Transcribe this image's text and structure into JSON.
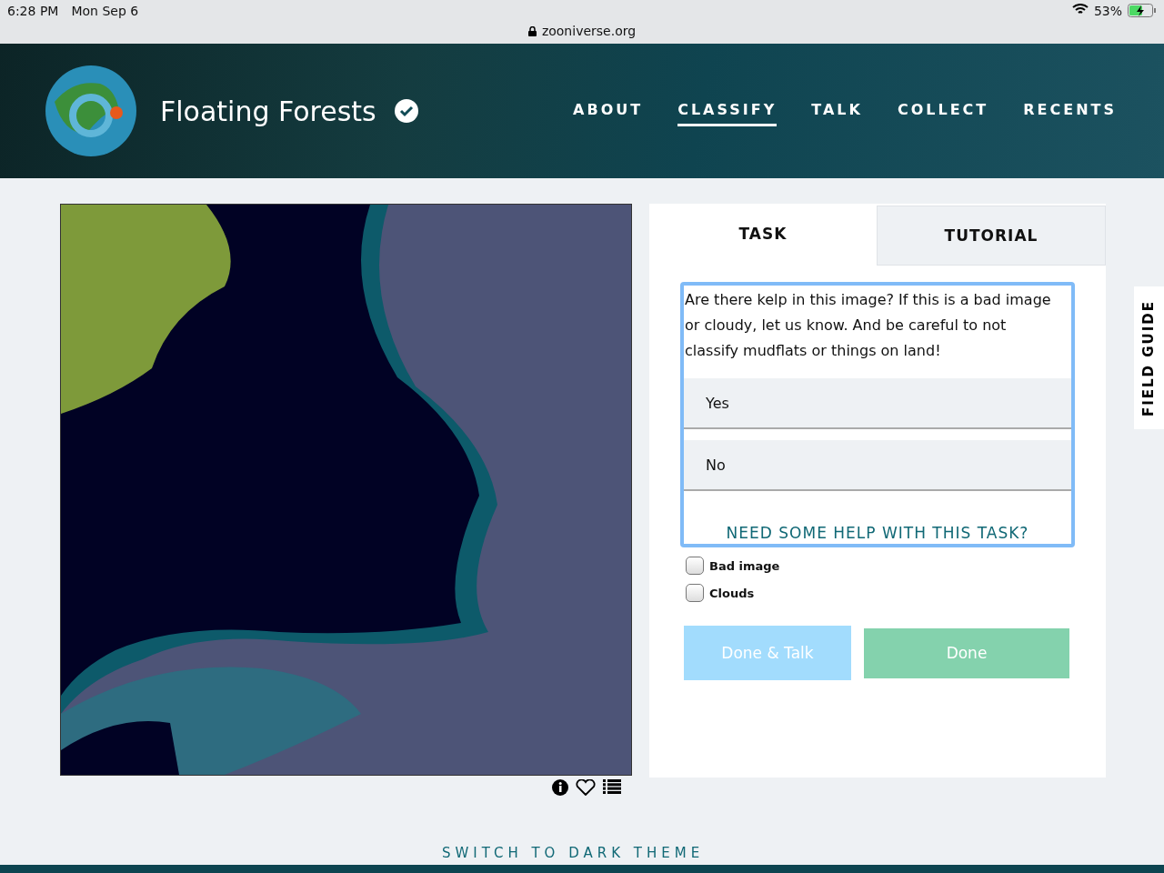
{
  "status_bar": {
    "time": "6:28 PM",
    "date": "Mon Sep 6",
    "battery": "53%",
    "address": "zooniverse.org"
  },
  "header": {
    "title": "Floating Forests",
    "verified": true,
    "nav": [
      {
        "label": "ABOUT",
        "selected": false
      },
      {
        "label": "CLASSIFY",
        "selected": true
      },
      {
        "label": "TALK",
        "selected": false
      },
      {
        "label": "COLLECT",
        "selected": false
      },
      {
        "label": "RECENTS",
        "selected": false
      }
    ]
  },
  "tabs": [
    {
      "label": "TASK",
      "selected": true
    },
    {
      "label": "TUTORIAL",
      "selected": false
    }
  ],
  "task": {
    "question": "Are there kelp in this image? If this is a bad image or cloudy, let us know. And be careful to not classify mudflats or things on land!",
    "answers": [
      {
        "label": "Yes",
        "selected": false
      },
      {
        "label": "No",
        "selected": false
      }
    ],
    "help": "NEED SOME HELP WITH THIS TASK?"
  },
  "checkboxes": [
    {
      "label": "Bad image",
      "checked": false
    },
    {
      "label": "Clouds",
      "checked": false
    }
  ],
  "buttons": [
    {
      "label": "Done & Talk",
      "kind": "talk"
    },
    {
      "label": "Done",
      "kind": "done"
    }
  ],
  "field_guide": "FIELD GUIDE",
  "theme_toggle": "SWITCH TO DARK THEME"
}
